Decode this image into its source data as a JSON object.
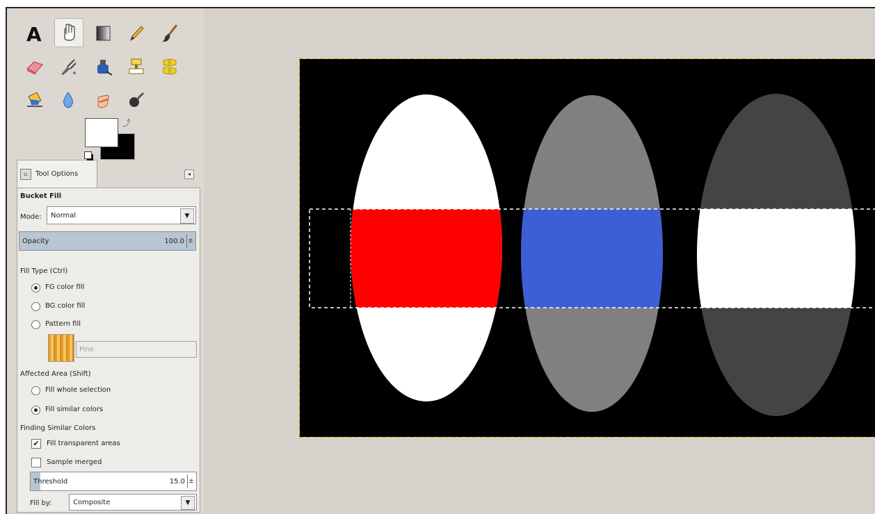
{
  "tool_options": {
    "tab_label": "Tool Options",
    "tool_name": "Bucket Fill",
    "mode_label": "Mode:",
    "mode_value": "Normal",
    "opacity_label": "Opacity",
    "opacity_value": "100.0",
    "opacity_percent": 100,
    "fill_type_label": "Fill Type  (Ctrl)",
    "fill_type_options": [
      "FG color fill",
      "BG color fill",
      "Pattern fill"
    ],
    "fill_type_selected": "FG color fill",
    "pattern_name": "Pine",
    "affected_area_label": "Affected Area  (Shift)",
    "affected_area_options": [
      "Fill whole selection",
      "Fill similar colors"
    ],
    "affected_area_selected": "Fill similar colors",
    "finding_label": "Finding Similar Colors",
    "fill_transparent_label": "Fill transparent areas",
    "fill_transparent_checked": true,
    "sample_merged_label": "Sample merged",
    "sample_merged_checked": false,
    "threshold_label": "Threshold",
    "threshold_value": "15.0",
    "fill_by_label": "Fill by:",
    "fill_by_value": "Composite"
  },
  "colors": {
    "foreground": "#ffffff",
    "background": "#000000",
    "ellipse_1": "#ffffff",
    "ellipse_2": "#808080",
    "ellipse_3": "#444444",
    "band_1": "#ff0000",
    "band_2": "#3c5fd6",
    "band_3": "#ffffff",
    "canvas_bg": "#000000"
  },
  "tools": [
    "text-icon",
    "heal-icon",
    "blend-icon",
    "pencil-icon",
    "paintbrush-icon",
    "eraser-icon",
    "airbrush-icon",
    "ink-icon",
    "clone-icon",
    "perspective-clone-icon",
    "bucket-icon",
    "blur-icon",
    "smudge-icon",
    "dodge-burn-icon"
  ]
}
